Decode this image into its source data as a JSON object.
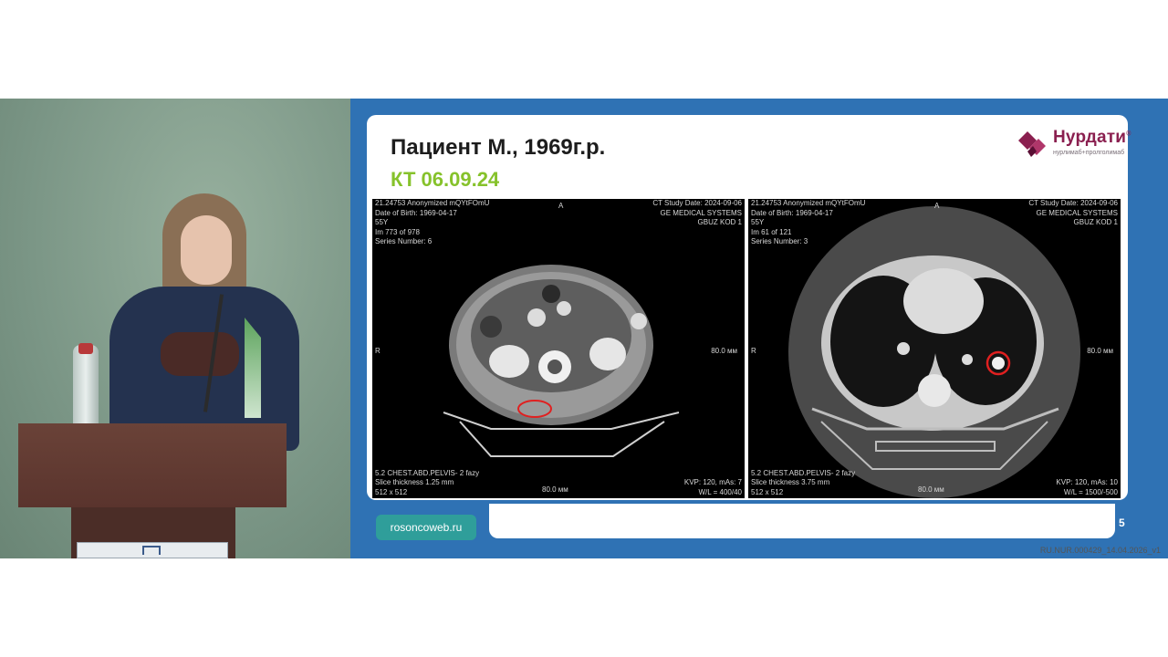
{
  "slide": {
    "title": "Пациент М., 1969г.р.",
    "subtitle": "КТ 06.09.24",
    "logo": {
      "name": "Нурдати",
      "tagline": "нурлимаб+пролголимаб",
      "registered_mark": "®"
    },
    "footer_url": "rosoncoweb.ru",
    "page_number": "5",
    "colors": {
      "background": "#2f72b4",
      "title": "#1d1d1d",
      "subtitle": "#86c22b",
      "url_pill": "#2f9e9a",
      "logo": "#8a1f4f"
    }
  },
  "ct_left": {
    "top_left": [
      "21.24753 Anonymized mQYtFOmU",
      "Date of Birth: 1969-04-17",
      "55Y",
      "Im 773 of 978",
      "Series Number: 6"
    ],
    "top_right": [
      "CT Study Date: 2024-09-06",
      "GE MEDICAL SYSTEMS",
      "GBUZ KOD 1"
    ],
    "orient_top": "A",
    "orient_left": "R",
    "scale_right": "80.0 мм",
    "scale_bottom": "80.0 мм",
    "bottom_left": [
      "5.2 CHEST.ABD.PELVIS- 2 fazy",
      "Slice thickness 1.25 mm",
      "512 x 512"
    ],
    "bottom_right": [
      "KVP: 120, mAs: 7",
      "W/L = 400/40"
    ]
  },
  "ct_right": {
    "top_left": [
      "21.24753 Anonymized mQYtFOmU",
      "Date of Birth: 1969-04-17",
      "55Y",
      "Im 61 of 121",
      "Series Number: 3"
    ],
    "top_right": [
      "CT Study Date: 2024-09-06",
      "GE MEDICAL SYSTEMS",
      "GBUZ KOD 1"
    ],
    "orient_top": "A",
    "orient_left": "R",
    "scale_right": "80.0 мм",
    "scale_bottom": "80.0 мм",
    "bottom_left": [
      "5.2 CHEST.ABD.PELVIS- 2 fazy",
      "Slice thickness 3.75 mm",
      "512 x 512"
    ],
    "bottom_right": [
      "KVP: 120, mAs: 10",
      "W/L = 1500/-500"
    ]
  },
  "document_code": "RU.NUR.000429_14.04.2026_v1"
}
